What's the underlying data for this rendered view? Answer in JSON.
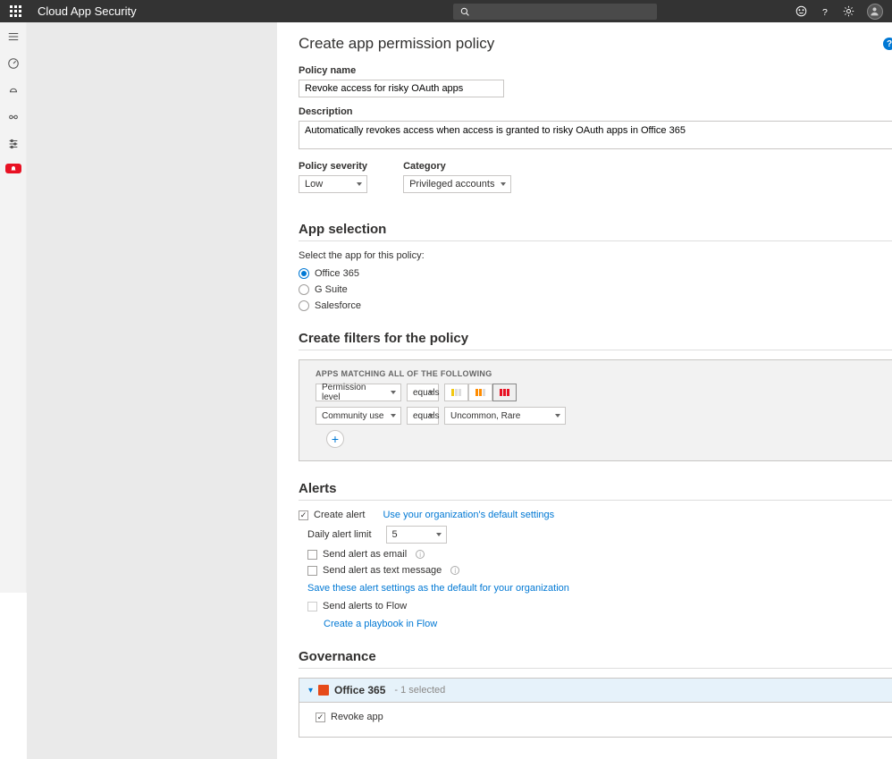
{
  "topbar": {
    "title": "Cloud App Security"
  },
  "page": {
    "title": "Create app permission policy"
  },
  "fields": {
    "policy_name_label": "Policy name",
    "policy_name_value": "Revoke access for risky OAuth apps",
    "description_label": "Description",
    "description_value": "Automatically revokes access when access is granted to risky OAuth apps in Office 365",
    "policy_severity_label": "Policy severity",
    "policy_severity_value": "Low",
    "category_label": "Category",
    "category_value": "Privileged accounts"
  },
  "app_selection": {
    "title": "App selection",
    "prompt": "Select the app for this policy:",
    "options": [
      {
        "label": "Office 365",
        "selected": true
      },
      {
        "label": "G Suite",
        "selected": false
      },
      {
        "label": "Salesforce",
        "selected": false
      }
    ]
  },
  "filters": {
    "title": "Create filters for the policy",
    "matching_label": "APPS MATCHING ALL OF THE FOLLOWING",
    "rows": [
      {
        "field": "Permission level",
        "op": "equals"
      },
      {
        "field": "Community use",
        "op": "equals",
        "value": "Uncommon, Rare"
      }
    ]
  },
  "alerts": {
    "title": "Alerts",
    "create_alert_label": "Create alert",
    "default_settings_link": "Use your organization's default settings",
    "daily_limit_label": "Daily alert limit",
    "daily_limit_value": "5",
    "send_email_label": "Send alert as email",
    "send_sms_label": "Send alert as text message",
    "save_defaults_link": "Save these alert settings as the default for your organization",
    "send_flow_label": "Send alerts to Flow",
    "create_playbook_link": "Create a playbook in Flow"
  },
  "governance": {
    "title": "Governance",
    "app_name": "Office 365",
    "selected_text": "- 1 selected",
    "revoke_label": "Revoke app"
  }
}
